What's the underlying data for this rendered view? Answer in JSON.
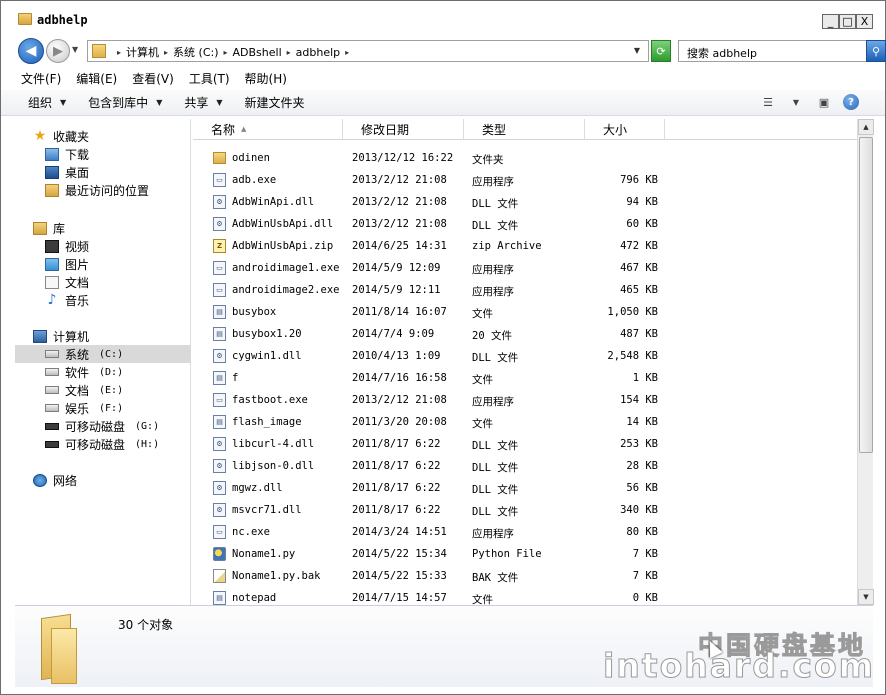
{
  "window": {
    "title": "adbhelp",
    "buttons": {
      "minimize": "_",
      "maximize": "□",
      "close": "X"
    }
  },
  "address": {
    "crumbs": [
      "计算机",
      "系统 (C:)",
      "ADBshell",
      "adbhelp"
    ],
    "search_placeholder": "搜索 adbhelp"
  },
  "menu": [
    "文件(F)",
    "编辑(E)",
    "查看(V)",
    "工具(T)",
    "帮助(H)"
  ],
  "commands": {
    "organize": "组织",
    "include_in_library": "包含到库中",
    "share": "共享",
    "new_folder": "新建文件夹"
  },
  "nav": {
    "favorites": {
      "label": "收藏夹",
      "items": [
        "下载",
        "桌面",
        "最近访问的位置"
      ]
    },
    "libraries": {
      "label": "库",
      "items": [
        "视频",
        "图片",
        "文档",
        "音乐"
      ]
    },
    "computer": {
      "label": "计算机",
      "drives": [
        {
          "name": "系统",
          "letter": "(C:)"
        },
        {
          "name": "软件",
          "letter": "(D:)"
        },
        {
          "name": "文档",
          "letter": "(E:)"
        },
        {
          "name": "娱乐",
          "letter": "(F:)"
        },
        {
          "name": "可移动磁盘",
          "letter": "(G:)"
        },
        {
          "name": "可移动磁盘",
          "letter": "(H:)"
        }
      ]
    },
    "network": {
      "label": "网络"
    }
  },
  "columns": {
    "name": "名称",
    "modified": "修改日期",
    "type": "类型",
    "size": "大小"
  },
  "files": [
    {
      "name": "odinen",
      "date": "2013/12/12 16:22",
      "type": "文件夹",
      "size": "",
      "icon": "folder"
    },
    {
      "name": "adb.exe",
      "date": "2013/2/12 21:08",
      "type": "应用程序",
      "size": "796 KB",
      "icon": "exe"
    },
    {
      "name": "AdbWinApi.dll",
      "date": "2013/2/12 21:08",
      "type": "DLL 文件",
      "size": "94 KB",
      "icon": "dll"
    },
    {
      "name": "AdbWinUsbApi.dll",
      "date": "2013/2/12 21:08",
      "type": "DLL 文件",
      "size": "60 KB",
      "icon": "dll"
    },
    {
      "name": "AdbWinUsbApi.zip",
      "date": "2014/6/25 14:31",
      "type": "zip Archive",
      "size": "472 KB",
      "icon": "zip"
    },
    {
      "name": "androidimage1.exe",
      "date": "2014/5/9 12:09",
      "type": "应用程序",
      "size": "467 KB",
      "icon": "exe"
    },
    {
      "name": "androidimage2.exe",
      "date": "2014/5/9 12:11",
      "type": "应用程序",
      "size": "465 KB",
      "icon": "exe"
    },
    {
      "name": "busybox",
      "date": "2011/8/14 16:07",
      "type": "文件",
      "size": "1,050 KB",
      "icon": "file"
    },
    {
      "name": "busybox1.20",
      "date": "2014/7/4 9:09",
      "type": "20 文件",
      "size": "487 KB",
      "icon": "file"
    },
    {
      "name": "cygwin1.dll",
      "date": "2010/4/13 1:09",
      "type": "DLL 文件",
      "size": "2,548 KB",
      "icon": "dll"
    },
    {
      "name": "f",
      "date": "2014/7/16 16:58",
      "type": "文件",
      "size": "1 KB",
      "icon": "file"
    },
    {
      "name": "fastboot.exe",
      "date": "2013/2/12 21:08",
      "type": "应用程序",
      "size": "154 KB",
      "icon": "exe"
    },
    {
      "name": "flash_image",
      "date": "2011/3/20 20:08",
      "type": "文件",
      "size": "14 KB",
      "icon": "file"
    },
    {
      "name": "libcurl-4.dll",
      "date": "2011/8/17 6:22",
      "type": "DLL 文件",
      "size": "253 KB",
      "icon": "dll"
    },
    {
      "name": "libjson-0.dll",
      "date": "2011/8/17 6:22",
      "type": "DLL 文件",
      "size": "28 KB",
      "icon": "dll"
    },
    {
      "name": "mgwz.dll",
      "date": "2011/8/17 6:22",
      "type": "DLL 文件",
      "size": "56 KB",
      "icon": "dll"
    },
    {
      "name": "msvcr71.dll",
      "date": "2011/8/17 6:22",
      "type": "DLL 文件",
      "size": "340 KB",
      "icon": "dll"
    },
    {
      "name": "nc.exe",
      "date": "2014/3/24 14:51",
      "type": "应用程序",
      "size": "80 KB",
      "icon": "exe"
    },
    {
      "name": "Noname1.py",
      "date": "2014/5/22 15:34",
      "type": "Python File",
      "size": "7 KB",
      "icon": "py"
    },
    {
      "name": "Noname1.py.bak",
      "date": "2014/5/22 15:33",
      "type": "BAK 文件",
      "size": "7 KB",
      "icon": "bak"
    },
    {
      "name": "notepad",
      "date": "2014/7/15 14:57",
      "type": "文件",
      "size": "0 KB",
      "icon": "file"
    }
  ],
  "status": {
    "count": "30 个对象"
  },
  "watermark": {
    "cn": "中国硬盘基地",
    "en": "intohard.com"
  }
}
